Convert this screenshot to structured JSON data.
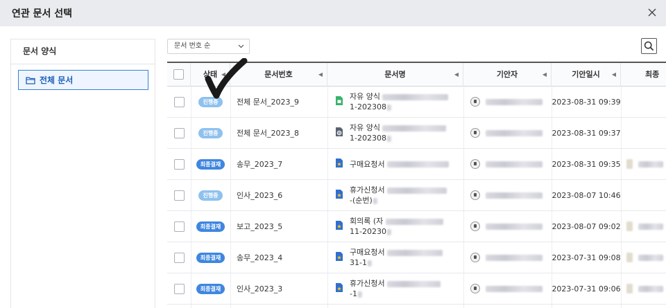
{
  "dialog": {
    "title": "연관 문서 선택"
  },
  "left_panel": {
    "header": "문서 양식",
    "folder_label": "전체 문서"
  },
  "toolbar": {
    "sort_selected": "문서 번호 순"
  },
  "table": {
    "columns": [
      "상태",
      "문서번호",
      "문서명",
      "기안자",
      "기안일시",
      "최종"
    ],
    "rows": [
      {
        "status": "진행중",
        "status_type": "progress",
        "doc_no": "전체 문서_2023_9",
        "icon": "green-doc-icon",
        "name_line1": "자유 양식",
        "name_line2": "1-202308",
        "date": "2023-08-31 09:39",
        "final": false
      },
      {
        "status": "진행중",
        "status_type": "progress",
        "doc_no": "전체 문서_2023_8",
        "icon": "globe-doc-icon",
        "name_line1": "자유 양식",
        "name_line2": "1-202308",
        "date": "2023-08-31 09:37",
        "final": false
      },
      {
        "status": "최종결재",
        "status_type": "final",
        "doc_no": "송무_2023_7",
        "icon": "star-doc-icon",
        "name_line1": "구매요청서",
        "name_line2": "",
        "date": "2023-08-31 09:35",
        "final": true
      },
      {
        "status": "진행중",
        "status_type": "progress",
        "doc_no": "인사_2023_6",
        "icon": "star-doc-icon",
        "name_line1": "휴가신청서",
        "name_line2": "-(순번)",
        "date": "2023-08-07 10:46",
        "final": false
      },
      {
        "status": "최종결재",
        "status_type": "final",
        "doc_no": "보고_2023_5",
        "icon": "star-doc-icon",
        "name_line1": "회의록 (자",
        "name_line2": "11-20230",
        "date": "2023-08-07 09:02",
        "final": true
      },
      {
        "status": "최종결재",
        "status_type": "final",
        "doc_no": "송무_2023_4",
        "icon": "star-doc-icon",
        "name_line1": "구매요청서",
        "name_line2": "31-1",
        "date": "2023-07-31 09:08",
        "final": true
      },
      {
        "status": "최종결재",
        "status_type": "final",
        "doc_no": "인사_2023_3",
        "icon": "star-doc-icon",
        "name_line1": "휴가신청서",
        "name_line2": "-1",
        "date": "2023-07-31 09:06",
        "final": true
      }
    ]
  },
  "colors": {
    "progress_badge": "#8fc1ee",
    "final_badge": "#3f86df",
    "selected_folder_border": "#3a7fd5",
    "titlebar_bg": "#e9ebee"
  }
}
